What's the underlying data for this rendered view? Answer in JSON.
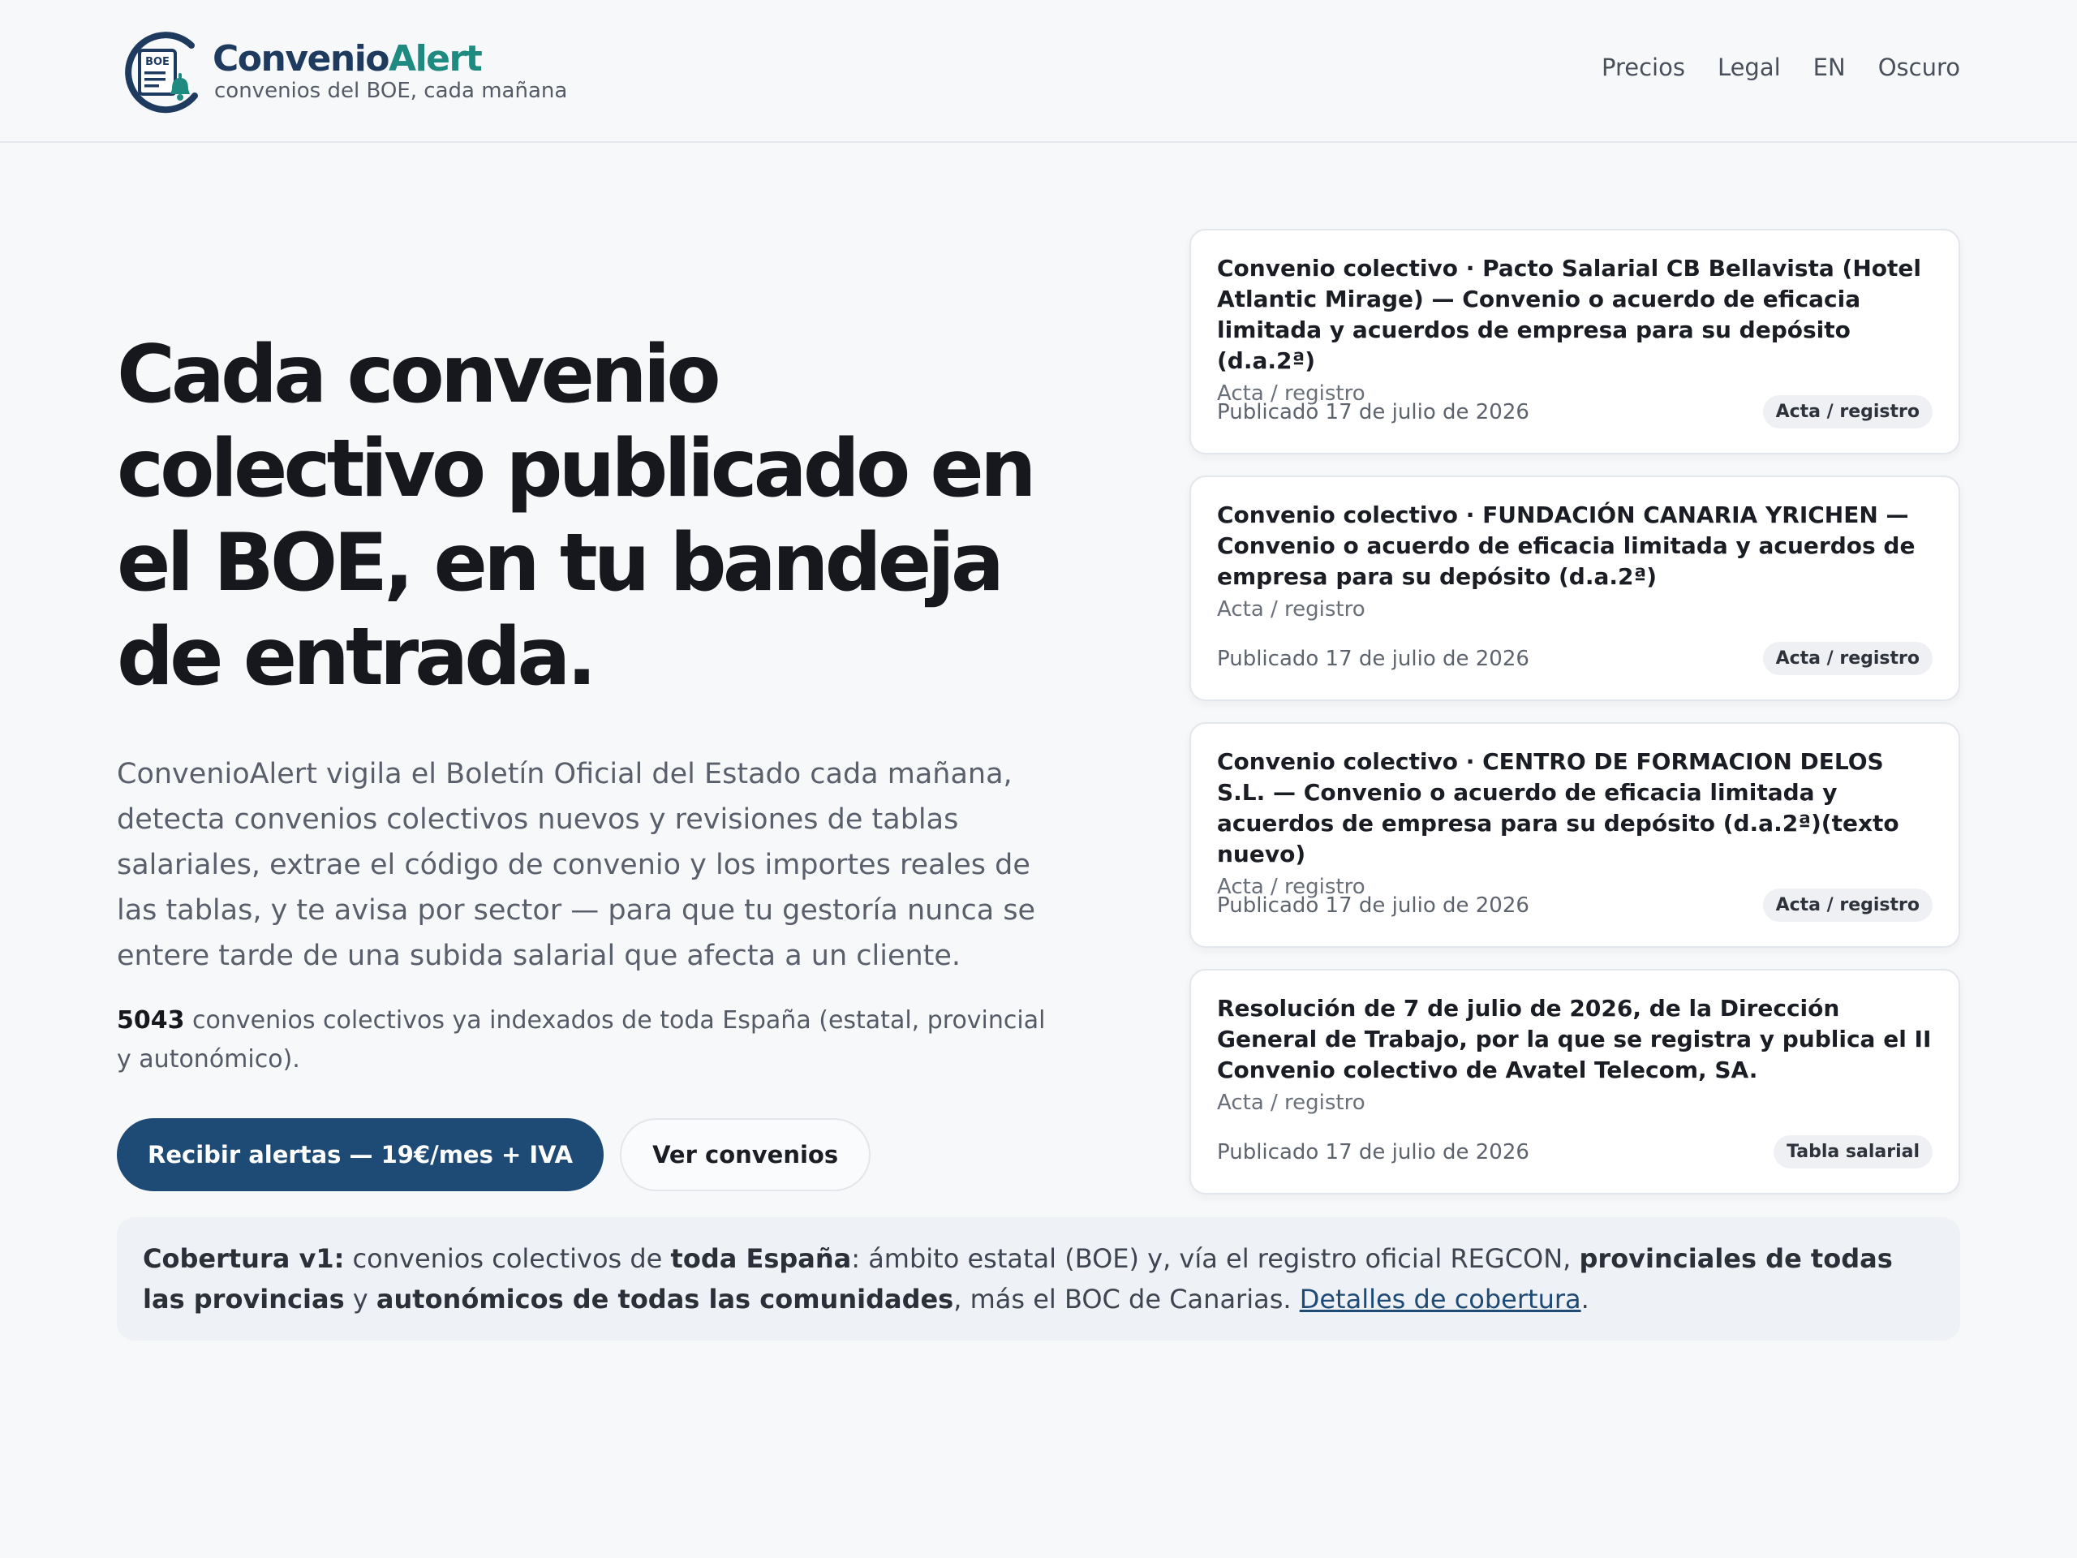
{
  "brand": {
    "name_part1": "Convenio",
    "name_part2": "Alert",
    "tagline": "convenios del BOE, cada mañana",
    "logo_label": "BOE",
    "colors": {
      "navy": "#1e3a5f",
      "teal": "#1f8a7f"
    }
  },
  "nav": [
    "Precios",
    "Legal",
    "EN",
    "Oscuro"
  ],
  "hero": {
    "title": "Cada convenio colectivo publicado en el BOE, en tu bandeja de entrada.",
    "lead": "ConvenioAlert vigila el Boletín Oficial del Estado cada mañana, detecta convenios colectivos nuevos y revisiones de tablas salariales, extrae el código de convenio y los importes reales de las tablas, y te avisa por sector — para que tu gestoría nunca se entere tarde de una subida salarial que afecta a un cliente.",
    "count_number": "5043",
    "count_text": " convenios colectivos ya indexados de toda España (estatal, provincial y autonómico).",
    "cta_primary": "Recibir alertas — 19€/mes + IVA",
    "cta_secondary": "Ver convenios"
  },
  "cards": [
    {
      "title": "Convenio colectivo · Pacto Salarial CB Bellavista (Hotel Atlantic Mirage) — Convenio o acuerdo de eficacia limitada y acuerdos de empresa para su depósito (d.a.2ª)",
      "type": "Acta / registro",
      "date": "Publicado 17 de julio de 2026",
      "badge": "Acta / registro"
    },
    {
      "title": "Convenio colectivo · FUNDACIÓN CANARIA YRICHEN — Convenio o acuerdo de eficacia limitada y acuerdos de empresa para su depósito (d.a.2ª)",
      "type": "Acta / registro",
      "date": "Publicado 17 de julio de 2026",
      "badge": "Acta / registro"
    },
    {
      "title": "Convenio colectivo · CENTRO DE FORMACION DELOS S.L. — Convenio o acuerdo de eficacia limitada y acuerdos de empresa para su depósito (d.a.2ª)(texto nuevo)",
      "type": "Acta / registro",
      "date": "Publicado 17 de julio de 2026",
      "badge": "Acta / registro"
    },
    {
      "title": "Resolución de 7 de julio de 2026, de la Dirección General de Trabajo, por la que se registra y publica el II Convenio colectivo de Avatel Telecom, SA.",
      "type": "Acta / registro",
      "date": "Publicado 17 de julio de 2026",
      "badge": "Tabla salarial"
    }
  ],
  "coverage": {
    "label": "Cobertura v1:",
    "t1": " convenios colectivos de ",
    "b1": "toda España",
    "t2": ": ámbito estatal (BOE) y, vía el registro oficial REGCON, ",
    "b2": "provinciales de todas las provincias",
    "t3": " y ",
    "b3": "autonómicos de todas las comunidades",
    "t4": ", más el BOC de Canarias. ",
    "link": "Detalles de cobertura",
    "t5": "."
  }
}
